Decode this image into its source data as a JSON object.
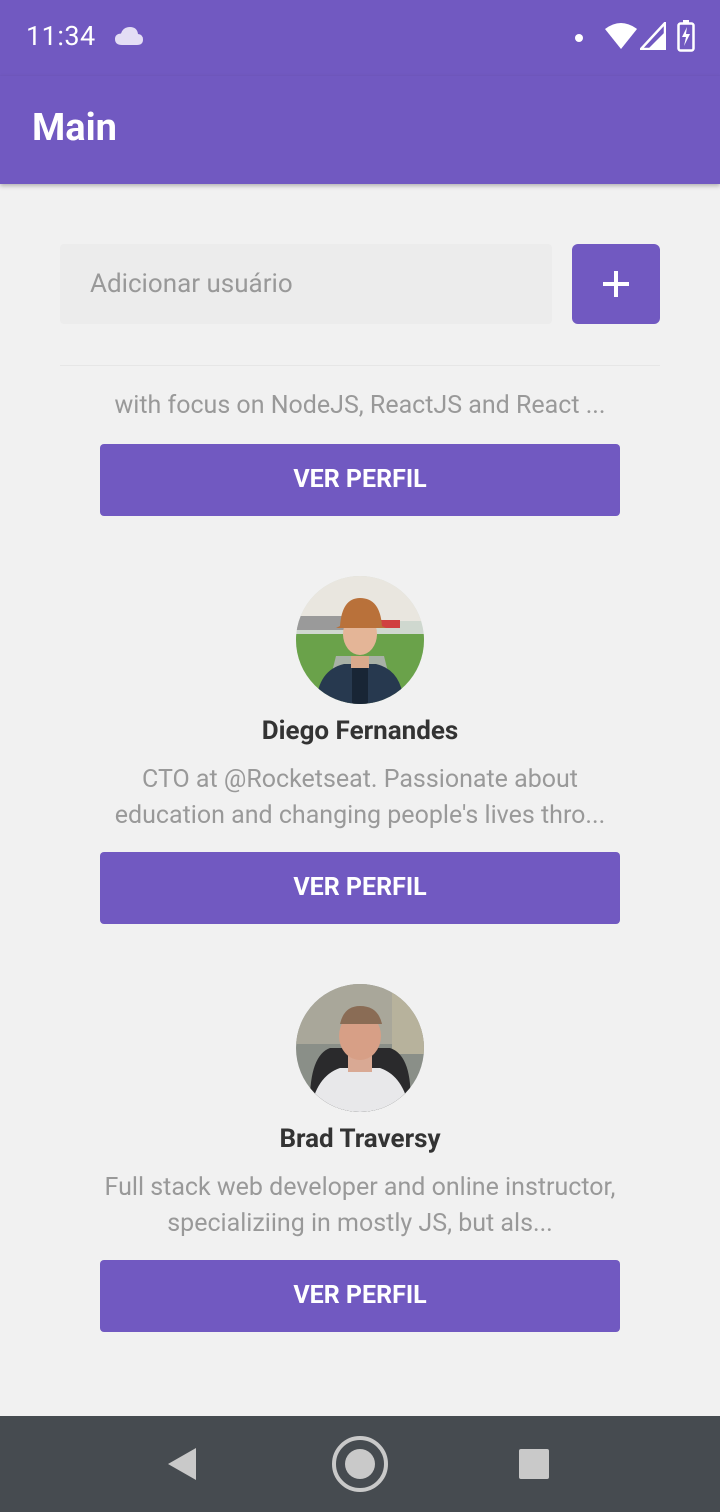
{
  "status_bar": {
    "time": "11:34"
  },
  "app_bar": {
    "title": "Main"
  },
  "form": {
    "placeholder": "Adicionar usuário",
    "add_icon": "plus-icon"
  },
  "users": [
    {
      "name": "",
      "bio": "with focus on NodeJS, ReactJS and React ...",
      "button_label": "VER PERFIL"
    },
    {
      "name": "Diego Fernandes",
      "bio": "CTO at @Rocketseat. Passionate about education and changing people's lives thro...",
      "button_label": "VER PERFIL"
    },
    {
      "name": "Brad Traversy",
      "bio": "Full stack web developer and online instructor, specializiing in mostly JS, but als...",
      "button_label": "VER PERFIL"
    }
  ],
  "colors": {
    "primary": "#7159c1",
    "background": "#f1f1f1",
    "nav_bar": "#464b50"
  }
}
